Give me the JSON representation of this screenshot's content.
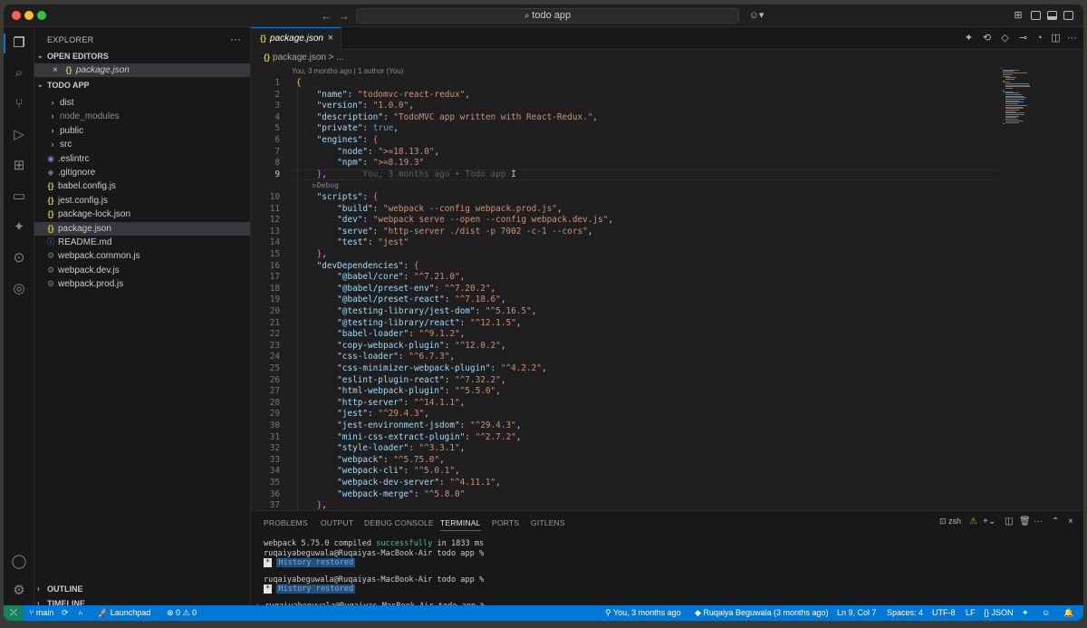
{
  "titlebar": {
    "search_text": "todo app",
    "back_icon": "arrow-left-icon",
    "forward_icon": "arrow-right-icon"
  },
  "sidebar": {
    "title": "EXPLORER",
    "open_editors_label": "OPEN EDITORS",
    "open_editor_file": "package.json",
    "project_label": "TODO APP",
    "items": [
      {
        "label": "dist",
        "type": "folder"
      },
      {
        "label": "node_modules",
        "type": "folder",
        "dimmed": true
      },
      {
        "label": "public",
        "type": "folder"
      },
      {
        "label": "src",
        "type": "folder"
      },
      {
        "label": ".eslintrc",
        "type": "eslint"
      },
      {
        "label": ".gitignore",
        "type": "git"
      },
      {
        "label": "babel.config.js",
        "type": "json"
      },
      {
        "label": "jest.config.js",
        "type": "json"
      },
      {
        "label": "package-lock.json",
        "type": "json"
      },
      {
        "label": "package.json",
        "type": "json",
        "selected": true
      },
      {
        "label": "README.md",
        "type": "info"
      },
      {
        "label": "webpack.common.js",
        "type": "gear"
      },
      {
        "label": "webpack.dev.js",
        "type": "gear"
      },
      {
        "label": "webpack.prod.js",
        "type": "gear"
      }
    ],
    "outline_label": "OUTLINE",
    "timeline_label": "TIMELINE"
  },
  "editor": {
    "tab_label": "package.json",
    "breadcrumb_file": "package.json",
    "breadcrumb_rest": "> ...",
    "blame_header": "You, 3 months ago | 1 author (You)",
    "inline_blame": "You, 3 months ago • Todo app",
    "debug_label": "Debug",
    "current_line": 9,
    "lines": [
      {
        "n": 1,
        "text": "{"
      },
      {
        "n": 2,
        "text": "    \"name\": \"todomvc-react-redux\","
      },
      {
        "n": 3,
        "text": "    \"version\": \"1.0.0\","
      },
      {
        "n": 4,
        "text": "    \"description\": \"TodoMVC app written with React-Redux.\","
      },
      {
        "n": 5,
        "text": "    \"private\": true,"
      },
      {
        "n": 6,
        "text": "    \"engines\": {"
      },
      {
        "n": 7,
        "text": "        \"node\": \">=18.13.0\","
      },
      {
        "n": 8,
        "text": "        \"npm\": \">=8.19.3\""
      },
      {
        "n": 9,
        "text": "    },"
      },
      {
        "n": 10,
        "text": "    \"scripts\": {"
      },
      {
        "n": 11,
        "text": "        \"build\": \"webpack --config webpack.prod.js\","
      },
      {
        "n": 12,
        "text": "        \"dev\": \"webpack serve --open --config webpack.dev.js\","
      },
      {
        "n": 13,
        "text": "        \"serve\": \"http-server ./dist -p 7002 -c-1 --cors\","
      },
      {
        "n": 14,
        "text": "        \"test\": \"jest\""
      },
      {
        "n": 15,
        "text": "    },"
      },
      {
        "n": 16,
        "text": "    \"devDependencies\": {"
      },
      {
        "n": 17,
        "text": "        \"@babel/core\": \"^7.21.0\","
      },
      {
        "n": 18,
        "text": "        \"@babel/preset-env\": \"^7.20.2\","
      },
      {
        "n": 19,
        "text": "        \"@babel/preset-react\": \"^7.18.6\","
      },
      {
        "n": 20,
        "text": "        \"@testing-library/jest-dom\": \"^5.16.5\","
      },
      {
        "n": 21,
        "text": "        \"@testing-library/react\": \"^12.1.5\","
      },
      {
        "n": 22,
        "text": "        \"babel-loader\": \"^9.1.2\","
      },
      {
        "n": 23,
        "text": "        \"copy-webpack-plugin\": \"^12.0.2\","
      },
      {
        "n": 24,
        "text": "        \"css-loader\": \"^6.7.3\","
      },
      {
        "n": 25,
        "text": "        \"css-minimizer-webpack-plugin\": \"^4.2.2\","
      },
      {
        "n": 26,
        "text": "        \"eslint-plugin-react\": \"^7.32.2\","
      },
      {
        "n": 27,
        "text": "        \"html-webpack-plugin\": \"^5.5.0\","
      },
      {
        "n": 28,
        "text": "        \"http-server\": \"^14.1.1\","
      },
      {
        "n": 29,
        "text": "        \"jest\": \"^29.4.3\","
      },
      {
        "n": 30,
        "text": "        \"jest-environment-jsdom\": \"^29.4.3\","
      },
      {
        "n": 31,
        "text": "        \"mini-css-extract-plugin\": \"^2.7.2\","
      },
      {
        "n": 32,
        "text": "        \"style-loader\": \"^3.3.1\","
      },
      {
        "n": 33,
        "text": "        \"webpack\": \"^5.75.0\","
      },
      {
        "n": 34,
        "text": "        \"webpack-cli\": \"^5.0.1\","
      },
      {
        "n": 35,
        "text": "        \"webpack-dev-server\": \"^4.11.1\","
      },
      {
        "n": 36,
        "text": "        \"webpack-merge\": \"^5.8.0\""
      },
      {
        "n": 37,
        "text": "    },"
      }
    ]
  },
  "panel": {
    "tabs": [
      "PROBLEMS",
      "OUTPUT",
      "DEBUG CONSOLE",
      "TERMINAL",
      "PORTS",
      "GITLENS"
    ],
    "active_tab": "TERMINAL",
    "shell_label": "zsh",
    "terminal": {
      "compile_prefix": "webpack 5.75.0 compiled ",
      "compile_status": "successfully",
      "compile_suffix": " in 1833 ms",
      "prompt": "ruqaiyabeguwala@Ruqaiyas-MacBook-Air todo app % ",
      "star": "*",
      "history": "History restored"
    }
  },
  "statusbar": {
    "branch": "main",
    "launchpad": "Launchpad",
    "problems": "0",
    "warnings": "0",
    "blame": "You, 3 months ago",
    "author": "Ruqaiya Beguwala (3 months ago)",
    "position": "Ln 9, Col 7",
    "spaces": "Spaces: 4",
    "encoding": "UTF-8",
    "eol": "LF",
    "language": "JSON",
    "brand_color": "#0078d4"
  }
}
